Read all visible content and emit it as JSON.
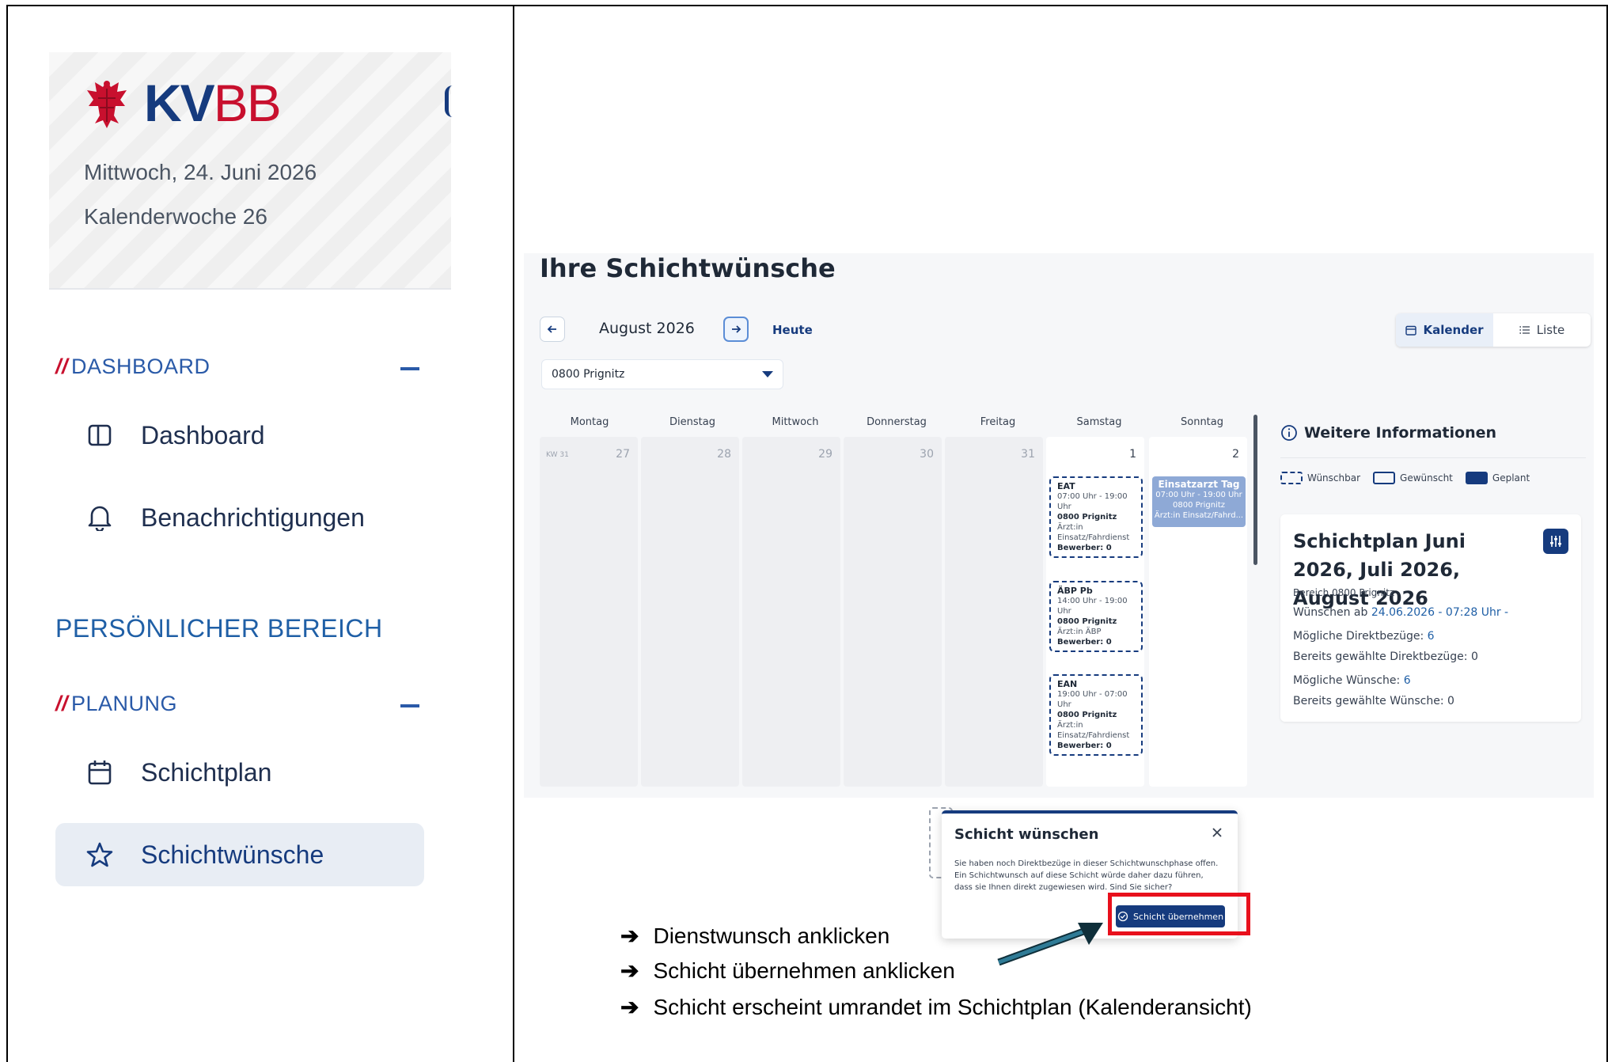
{
  "sidebar": {
    "logo_kv": "KV",
    "logo_bb": "BB",
    "date": "Mittwoch, 24. Juni 2026",
    "week": "Kalenderwoche 26",
    "section_dashboard": {
      "slash": "//",
      "label": "DASHBOARD"
    },
    "items": [
      {
        "label": "Dashboard",
        "icon": "sidebar-panel-icon"
      },
      {
        "label": "Benachrichtigungen",
        "icon": "bell-icon"
      }
    ],
    "persoenlich": "PERSÖNLICHER BEREICH",
    "section_planung": {
      "slash": "//",
      "label": "PLANUNG"
    },
    "planung_items": [
      {
        "label": "Schichtplan",
        "icon": "calendar-icon"
      },
      {
        "label": "Schichtwünsche",
        "icon": "star-icon",
        "active": true
      }
    ]
  },
  "main": {
    "title": "Ihre Schichtwünsche",
    "month": "August 2026",
    "today": "Heute",
    "view_calendar": "Kalender",
    "view_list": "Liste",
    "region_select": "0800 Prignitz",
    "weekdays": [
      "Montag",
      "Dienstag",
      "Mittwoch",
      "Donnerstag",
      "Freitag",
      "Samstag",
      "Sonntag"
    ],
    "kw": "KW 31",
    "days": [
      "27",
      "28",
      "29",
      "30",
      "31",
      "1",
      "2"
    ],
    "shifts": [
      {
        "title": "EAT",
        "time": "07:00 Uhr - 19:00 Uhr",
        "area": "0800 Prignitz",
        "role": "Ärzt:in Einsatz/Fahrdienst",
        "applicants": "Bewerber: 0"
      },
      {
        "title": "ÄBP Pb",
        "time": "14:00 Uhr - 19:00 Uhr",
        "area": "0800 Prignitz",
        "role": "Ärzt:in ÄBP",
        "applicants": "Bewerber: 0"
      },
      {
        "title": "EAN",
        "time": "19:00 Uhr - 07:00 Uhr",
        "area": "0800 Prignitz",
        "role": "Ärzt:in Einsatz/Fahrdienst",
        "applicants": "Bewerber: 0"
      }
    ],
    "planned": {
      "title": "Einsatzarzt Tag",
      "time": "07:00 Uhr - 19:00 Uhr",
      "area": "0800 Prignitz",
      "role": "Ärzt:in Einsatz/Fahrd..."
    },
    "info": {
      "title": "Weitere Informationen",
      "legend": [
        "Wünschbar",
        "Gewünscht",
        "Geplant"
      ],
      "plan_title": "Schichtplan Juni 2026, Juli 2026, August 2026",
      "bereich": "Bereich 0800 Prignitz",
      "wuenschen_label": "Wünschen ab",
      "wuenschen_value": "24.06.2026 - 07:28 Uhr -",
      "direkt_label": "Mögliche Direktbezüge:",
      "direkt_value": "6",
      "gew_direkt_label": "Bereits gewählte Direktbezüge:",
      "gew_direkt_value": "0",
      "wuensche_label": "Mögliche Wünsche:",
      "wuensche_value": "6",
      "gew_wuensche_label": "Bereits gewählte Wünsche:",
      "gew_wuensche_value": "0"
    }
  },
  "dialog": {
    "title": "Schicht wünschen",
    "text": "Sie haben noch Direktbezüge in dieser Schichtwunschphase offen. Ein Schichtwunsch auf diese Schicht würde daher dazu führen, dass sie Ihnen direkt zugewiesen wird. Sind Sie sicher?",
    "confirm": "Schicht übernehmen"
  },
  "instructions": [
    "Dienstwunsch anklicken",
    "Schicht übernehmen anklicken",
    "Schicht erscheint umrandet im Schichtplan (Kalenderansicht)"
  ],
  "instruction_arrow": "➔",
  "colors": {
    "brand_blue": "#163b7e",
    "brand_red": "#c8102e",
    "highlight": "#e8101c",
    "planned": "#8ea9d6"
  }
}
